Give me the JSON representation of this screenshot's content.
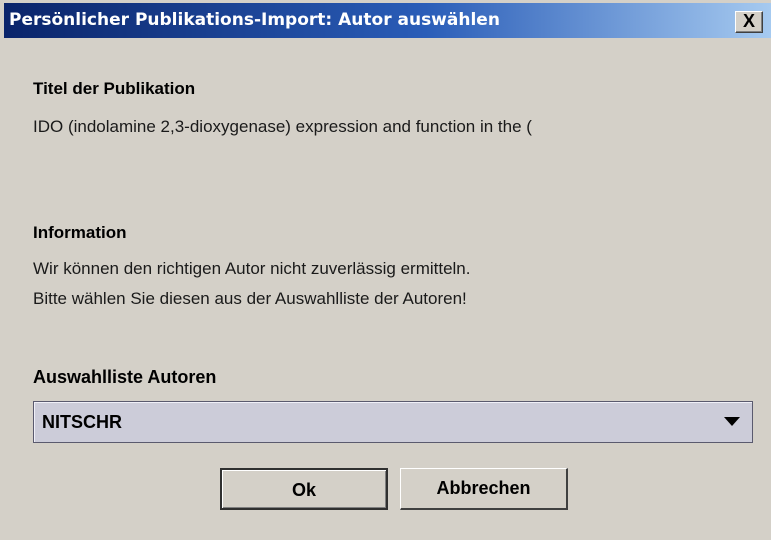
{
  "window": {
    "title": "Persönlicher Publikations-Import: Autor auswählen",
    "close_label": "X"
  },
  "publication": {
    "heading": "Titel der Publikation",
    "value": "IDO (indolamine 2,3-dioxygenase) expression and function in the ("
  },
  "information": {
    "heading": "Information",
    "line1": "Wir können den richtigen Autor nicht zuverlässig ermitteln.",
    "line2": "Bitte wählen Sie diesen aus der Auswahlliste der Autoren!"
  },
  "authors": {
    "heading": "Auswahlliste Autoren",
    "selected": "NITSCHR"
  },
  "buttons": {
    "ok": "Ok",
    "cancel": "Abbrechen"
  },
  "colors": {
    "titlebar_start": "#0a246a",
    "titlebar_end": "#a6caf0",
    "dialog_background": "#d4d0c8",
    "select_background": "#ccccd9"
  },
  "icons": {
    "close": "close-icon",
    "dropdown": "chevron-down-icon"
  }
}
